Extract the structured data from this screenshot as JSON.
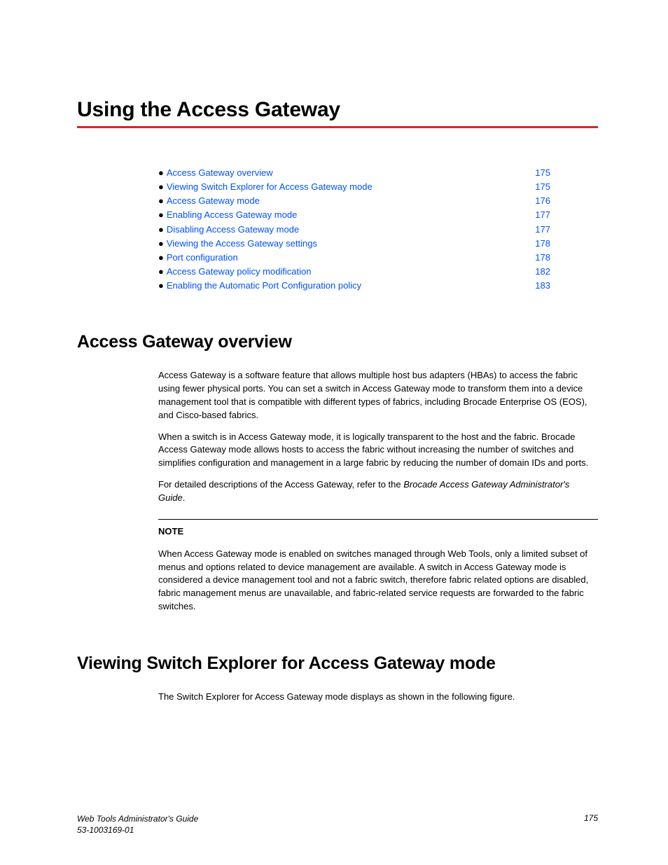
{
  "chapter": {
    "title": "Using the Access Gateway"
  },
  "toc": [
    {
      "label": "Access Gateway overview",
      "page": "175"
    },
    {
      "label": "Viewing Switch Explorer for Access Gateway mode",
      "page": "175"
    },
    {
      "label": "Access Gateway mode ",
      "page": "176"
    },
    {
      "label": "Enabling Access Gateway mode",
      "page": "177"
    },
    {
      "label": "Disabling Access Gateway mode",
      "page": "177"
    },
    {
      "label": "Viewing the Access Gateway settings",
      "page": "178"
    },
    {
      "label": "Port configuration",
      "page": "178"
    },
    {
      "label": "Access Gateway policy modification",
      "page": "182"
    },
    {
      "label": "Enabling the Automatic Port Configuration policy",
      "page": "183"
    }
  ],
  "sections": {
    "overview": {
      "title": "Access Gateway overview",
      "p1": "Access Gateway is a software feature that allows multiple host bus adapters (HBAs) to access the fabric using fewer physical ports. You can set a switch in Access Gateway mode to transform them into a device management tool that is compatible with different types of fabrics, including Brocade Enterprise OS (EOS), and Cisco-based fabrics.",
      "p2": "When a switch is in Access Gateway mode, it is logically transparent to the host and the fabric. Brocade Access Gateway mode allows hosts to access the fabric without increasing the number of switches and simplifies configuration and management in a large fabric by reducing the number of domain IDs and ports.",
      "p3a": "For detailed descriptions of the Access Gateway, refer to the ",
      "p3b": "Brocade Access Gateway Administrator's Guide",
      "p3c": ".",
      "note_label": "NOTE",
      "note_text": "When Access Gateway mode is enabled on switches managed through Web Tools, only a limited subset of menus and options related to device management are available. A switch in Access Gateway mode is considered a device management tool and not a fabric switch, therefore fabric related options are disabled, fabric management menus are unavailable, and fabric-related service requests are forwarded to the fabric switches."
    },
    "viewing": {
      "title": "Viewing Switch Explorer for Access Gateway mode",
      "p1": "The Switch Explorer for Access Gateway mode displays as shown in the following figure."
    }
  },
  "footer": {
    "doc_title": "Web Tools Administrator's Guide",
    "doc_id": "53-1003169-01",
    "page": "175"
  }
}
